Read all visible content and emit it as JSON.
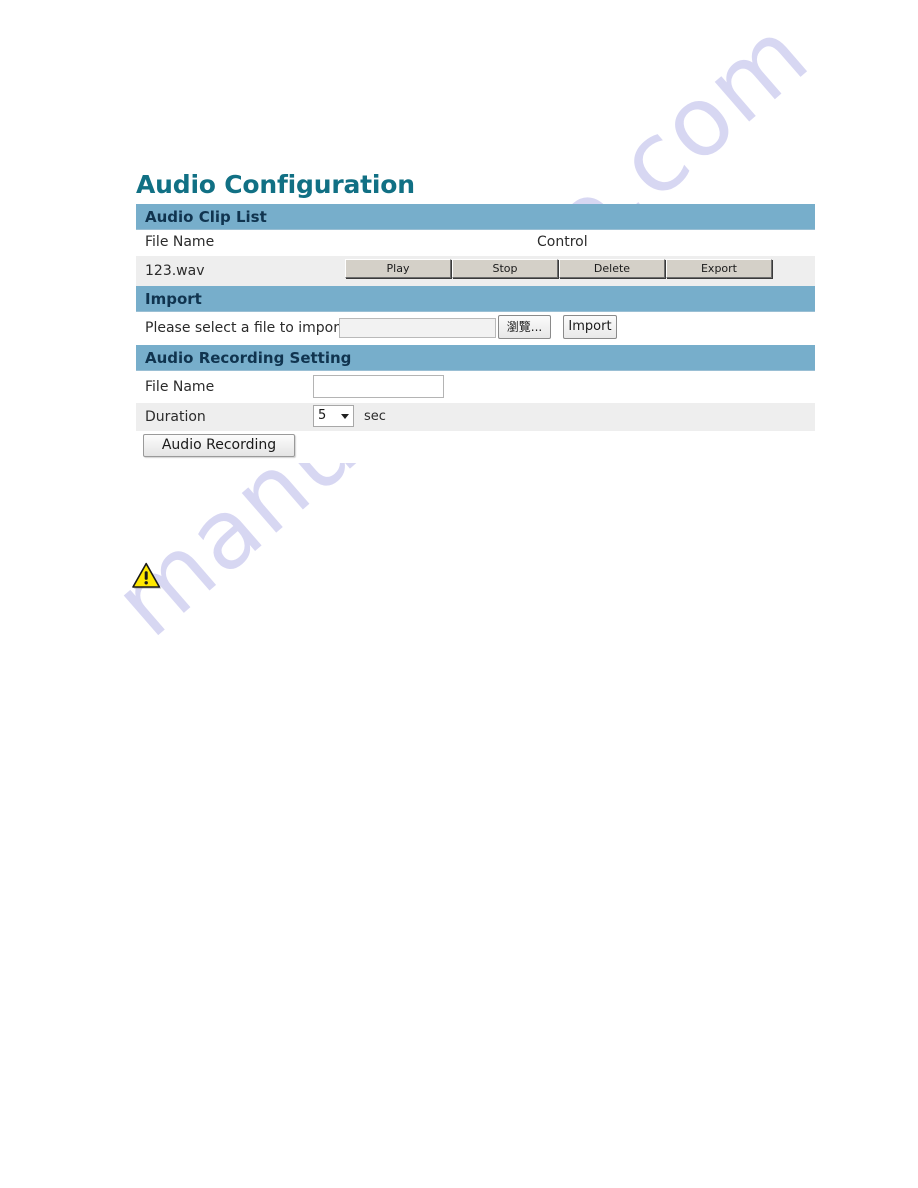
{
  "page": {
    "title": "Audio Configuration",
    "title_color": "#117084",
    "header_bar_color": "#77aecb",
    "header_text_color": "#10344f",
    "shaded_row_color": "#eeeeee",
    "watermark_text": "manualshive.com",
    "watermark_color": "#c9c8ee"
  },
  "audio_clip_list": {
    "section_title": "Audio Clip List",
    "columns": [
      "File Name",
      "Control"
    ],
    "rows": [
      {
        "file_name": "123.wav",
        "controls": [
          "Play",
          "Stop",
          "Delete",
          "Export"
        ]
      }
    ]
  },
  "import": {
    "section_title": "Import",
    "label": "Please select a file to import",
    "file_field_value": "",
    "file_field_placeholder": "",
    "browse_label": "瀏覽...",
    "import_label": "Import"
  },
  "audio_recording_setting": {
    "section_title": "Audio Recording Setting",
    "file_name_label": "File Name",
    "file_name_value": "",
    "file_name_placeholder": "",
    "duration_label": "Duration",
    "duration_value": "5",
    "duration_unit": "sec",
    "record_button_label": "Audio Recording"
  },
  "note": {
    "icon": "warning-triangle-icon",
    "icon_fill": "#ffe800",
    "icon_stroke": "#1a1a1a"
  }
}
